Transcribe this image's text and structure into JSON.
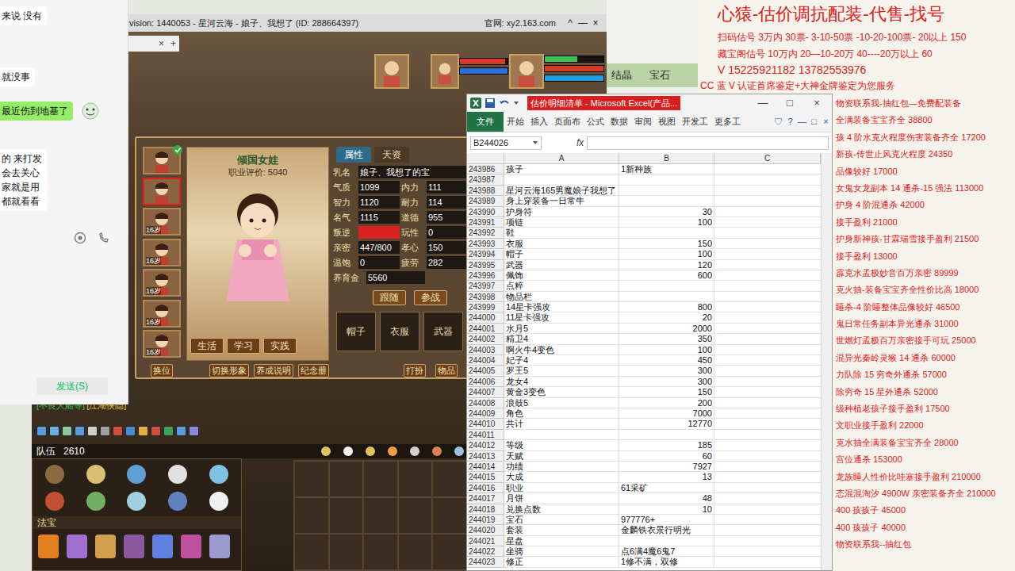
{
  "chat_panel": {
    "messages": [
      {
        "lines": [
          "来说 没有"
        ],
        "kind": "incoming"
      },
      {
        "lines": [
          "就没事"
        ],
        "kind": "incoming"
      },
      {
        "lines": [
          "最近伤到地基了"
        ],
        "kind": "outgoing"
      },
      {
        "lines": [
          "的 来打发",
          "会去关心",
          "家就是用",
          "都就看看"
        ],
        "kind": "incoming"
      }
    ],
    "send_button": "发送(S)"
  },
  "side_window": {
    "labels": [
      "结晶",
      "宝石"
    ]
  },
  "game_window": {
    "title": "vision: 1440053 - 星河云海 - 娘子、我想了 (ID: 288664397)",
    "site": "官网: xy2.163.com",
    "controls": [
      "^",
      "—",
      "×"
    ],
    "tab_strip": [
      "×",
      "+"
    ],
    "status_bars": [
      {
        "color": "#d83a2a",
        "level": 0.95
      },
      {
        "color": "#2a6fd8",
        "level": 1
      },
      {
        "color": "#3cc050",
        "level": 0.55
      },
      {
        "color": "#d83a2a",
        "level": 1
      },
      {
        "color": "#1e9ee0",
        "level": 1
      }
    ],
    "child_panel": {
      "title": "倾国女娃",
      "rating": "职业评价: 5040",
      "portraits": [
        {
          "label": "",
          "selected": false,
          "checked": true
        },
        {
          "label": "",
          "selected": true,
          "checked": false
        },
        {
          "label": "16岁",
          "selected": false,
          "checked": false
        },
        {
          "label": "16岁",
          "selected": false,
          "checked": false
        },
        {
          "label": "16岁",
          "selected": false,
          "checked": false
        },
        {
          "label": "16岁",
          "selected": false,
          "checked": false
        },
        {
          "label": "16岁",
          "selected": false,
          "checked": false
        }
      ],
      "tabs": [
        {
          "label": "属性",
          "selected": true
        },
        {
          "label": "天资",
          "selected": false
        }
      ],
      "name": {
        "label": "乳名",
        "value": "娘子、我想了的宝"
      },
      "fields": [
        {
          "label": "气质",
          "value": "1099",
          "alert": false
        },
        {
          "label": "内力",
          "value": "111",
          "alert": false
        },
        {
          "label": "智力",
          "value": "1120",
          "alert": false
        },
        {
          "label": "耐力",
          "value": "114",
          "alert": false
        },
        {
          "label": "名气",
          "value": "1115",
          "alert": false
        },
        {
          "label": "道德",
          "value": "955",
          "alert": false
        },
        {
          "label": "叛逆",
          "value": "",
          "alert": true
        },
        {
          "label": "玩性",
          "value": "0",
          "alert": false
        },
        {
          "label": "亲密",
          "value": "447/800",
          "alert": false
        },
        {
          "label": "孝心",
          "value": "150",
          "alert": false
        },
        {
          "label": "温饱",
          "value": "0",
          "alert": false
        },
        {
          "label": "疲劳",
          "value": "282",
          "alert": false
        }
      ],
      "fund": {
        "label": "养育金",
        "value": "5560"
      },
      "actions": [
        "跟随",
        "参战"
      ],
      "image_buttons": [
        "生活",
        "学习",
        "实践"
      ],
      "slots": [
        "帽子",
        "衣服",
        "武器"
      ],
      "bottom_buttons": [
        "换位",
        "切换形象",
        "养成说明",
        "纪念册"
      ],
      "right_buttons": [
        "打扮",
        "物品"
      ]
    },
    "chat_line": [
      {
        "text": "[不良人船等]",
        "color": "#3cc050"
      },
      {
        "text": "[江湖侠隐]",
        "color": "#e8c040"
      }
    ],
    "team": {
      "label": "队伍",
      "value": "2610"
    },
    "fabao": "法宝"
  },
  "excel": {
    "title": "估价明细清单 - Microsoft Excel(产品...",
    "controls": [
      "—",
      "□",
      "×"
    ],
    "ribbon": [
      {
        "label": "文件",
        "selected": true
      },
      {
        "label": "开始",
        "selected": false
      },
      {
        "label": "插入",
        "selected": false
      },
      {
        "label": "页面布",
        "selected": false
      },
      {
        "label": "公式",
        "selected": false
      },
      {
        "label": "数据",
        "selected": false
      },
      {
        "label": "审阅",
        "selected": false
      },
      {
        "label": "视图",
        "selected": false
      },
      {
        "label": "开发工",
        "selected": false
      },
      {
        "label": "更多工",
        "selected": false
      }
    ],
    "ribbon_icons": [
      "♡",
      "?",
      "—",
      "□",
      "×"
    ],
    "name_box": "B244026",
    "fx": "fx",
    "columns": [
      "A",
      "B",
      "C"
    ],
    "rows": [
      {
        "num": "243986",
        "a": "孩子",
        "b": "1新种族"
      },
      {
        "num": "243987",
        "a": "",
        "b": ""
      },
      {
        "num": "243988",
        "a": "星河云海165男魔娘子我想了",
        "b": ""
      },
      {
        "num": "243989",
        "a": "身上穿装备一日常牛",
        "b": ""
      },
      {
        "num": "243990",
        "a": "护身符",
        "b": "30"
      },
      {
        "num": "243991",
        "a": "项链",
        "b": "100"
      },
      {
        "num": "243992",
        "a": "鞋",
        "b": ""
      },
      {
        "num": "243993",
        "a": "衣服",
        "b": "150"
      },
      {
        "num": "243994",
        "a": "帽子",
        "b": "100"
      },
      {
        "num": "243995",
        "a": "武器",
        "b": "120"
      },
      {
        "num": "243996",
        "a": "佩饰",
        "b": "600"
      },
      {
        "num": "243997",
        "a": "点粹",
        "b": ""
      },
      {
        "num": "243998",
        "a": "物品栏",
        "b": ""
      },
      {
        "num": "243999",
        "a": "14星卡强攻",
        "b": "800"
      },
      {
        "num": "244000",
        "a": "11星卡强攻",
        "b": "20"
      },
      {
        "num": "244001",
        "a": "水月5",
        "b": "2000"
      },
      {
        "num": "244002",
        "a": "精卫4",
        "b": "350"
      },
      {
        "num": "244003",
        "a": "啊火牛4变色",
        "b": "100"
      },
      {
        "num": "244004",
        "a": "妃子4",
        "b": "450"
      },
      {
        "num": "244005",
        "a": "罗王5",
        "b": "300"
      },
      {
        "num": "244006",
        "a": "龙女4",
        "b": "300"
      },
      {
        "num": "244007",
        "a": "黄金3变色",
        "b": "150"
      },
      {
        "num": "244008",
        "a": "浪鼓5",
        "b": "200"
      },
      {
        "num": "244009",
        "a": "角色",
        "b": "7000"
      },
      {
        "num": "244010",
        "a": "共计",
        "b": "12770"
      },
      {
        "num": "244011",
        "a": "",
        "b": ""
      },
      {
        "num": "244012",
        "a": "等级",
        "b": "185"
      },
      {
        "num": "244013",
        "a": "天赋",
        "b": "60"
      },
      {
        "num": "244014",
        "a": "功绩",
        "b": "7927"
      },
      {
        "num": "244015",
        "a": "大成",
        "b": "13"
      },
      {
        "num": "244016",
        "a": "职业",
        "b": "61采矿"
      },
      {
        "num": "244017",
        "a": "月饼",
        "b": "48"
      },
      {
        "num": "244018",
        "a": "兑换点数",
        "b": "10"
      },
      {
        "num": "244019",
        "a": "宝石",
        "b": "977776+"
      },
      {
        "num": "244020",
        "a": "套装",
        "b": "金麟铁衣景行明光"
      },
      {
        "num": "244021",
        "a": "星盘",
        "b": ""
      },
      {
        "num": "244022",
        "a": "坐骑",
        "b": "点6满4魔6鬼7"
      },
      {
        "num": "244023",
        "a": "修正",
        "b": "1修不满，双修"
      }
    ]
  },
  "ad_panel": {
    "title": "心猿-估价调抗配装-代售-找号",
    "lines": [
      "扫码估号 3万内 30票- 3-10-50票  -10-20-100票- 20以上 150",
      "藏宝阁估号 10万内 20—10-20万 40----20万以上 60",
      "V 15225921182  13782553976",
      "CC 蓝 V 认证首席鉴定+大神金牌鉴定为您服务"
    ],
    "items": [
      "物资联系我-抽红包—免费配装备",
      "全满装备宝宝齐全 38800",
      "孩 4 阶水克火程度伤害装备齐全 17200",
      "新孩-传世止风克火程度 24350",
      "品像较好 17000",
      "女鬼女龙副本 14 通杀-15 强法 113000",
      "护身 4 阶混通杀 42000",
      "接手盈利 21000",
      "护身新神孩-甘霖瑞雪接手盈利 21500",
      "接手盈利 13000",
      "霹克水孟极妙音百万亲密 89999",
      "克火抽-装备宝宝齐全性价比高 18000",
      "睡杀-4 阶睡整体品像较好 46500",
      "鬼日常任务副本异光通杀 31000",
      "世燃灯孟极百万亲密接手可玩 25000",
      "混异光秦岭灵猴 14 通杀 60000",
      "力队除 15 穷奇外通杀 57000",
      "除穷奇 15 星外通杀 52000",
      "级种植老孩子接手盈利 17500",
      "文职业接手盈利 22000",
      "克水抽全满装备宝宝齐全 28000",
      "宫位通杀 153000",
      "龙族睡人性价比哇塞接手盈利 210000",
      "态混混淘汐 4900W 亲密装备齐全 210000",
      "400 孩孩子 45000",
      "400 孩孩子 40000",
      "物资联系我--抽红包"
    ]
  }
}
